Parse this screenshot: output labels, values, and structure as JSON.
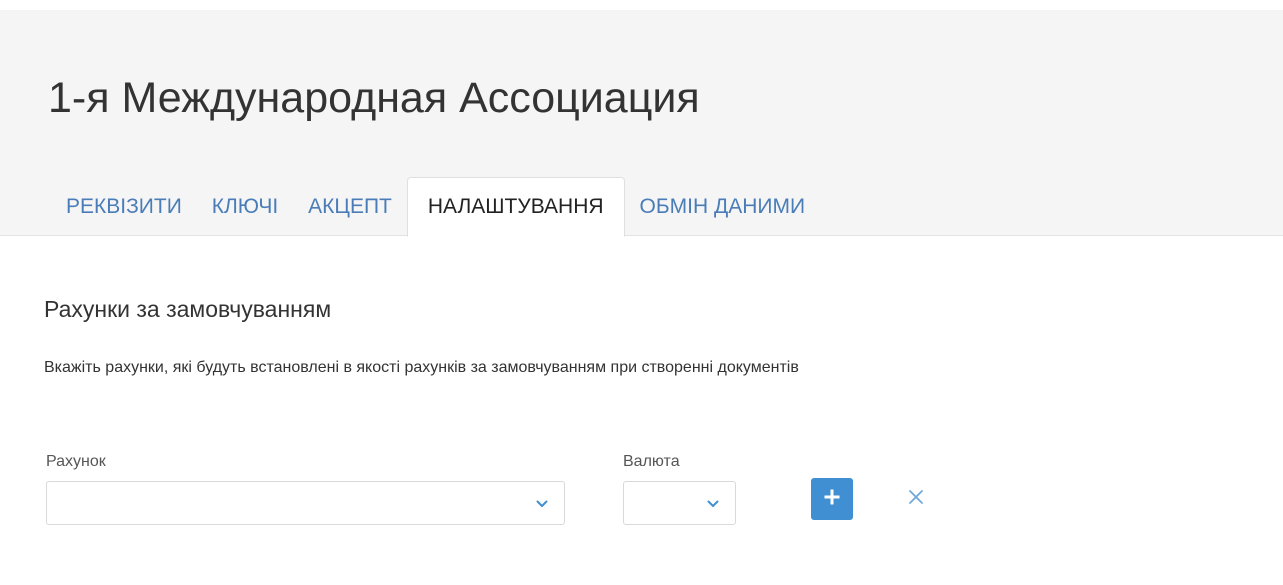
{
  "header": {
    "title": "1-я Международная Ассоциация"
  },
  "tabs": [
    {
      "label": "РЕКВІЗИТИ",
      "active": false
    },
    {
      "label": "КЛЮЧІ",
      "active": false
    },
    {
      "label": "АКЦЕПТ",
      "active": false
    },
    {
      "label": "НАЛАШТУВАННЯ",
      "active": true
    },
    {
      "label": "ОБМІН ДАНИМИ",
      "active": false
    }
  ],
  "section": {
    "title": "Рахунки за замовчуванням",
    "description": "Вкажіть рахунки, які будуть встановлені в якості рахунків за замовчуванням при створенні документів"
  },
  "form": {
    "account_label": "Рахунок",
    "account_value": "",
    "currency_label": "Валюта",
    "currency_value": "",
    "add_icon": "plus-icon",
    "clear_icon": "close-icon"
  },
  "colors": {
    "header_bg": "#f5f5f5",
    "tab_link": "#4a7db8",
    "active_tab_text": "#222222",
    "primary_button": "#3f8fd2",
    "chevron": "#3f8fd2",
    "clear_icon": "#6fa8dc"
  }
}
